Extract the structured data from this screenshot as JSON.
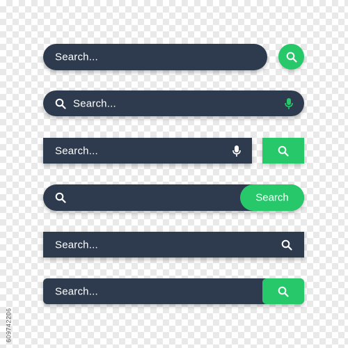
{
  "colors": {
    "bar": "#2e3b4e",
    "accent": "#27c86a",
    "text": "#ffffff"
  },
  "icons": [
    "search-icon",
    "microphone-icon"
  ],
  "search_bars": [
    {
      "placeholder": "Search...",
      "style": "rounded",
      "trailing_icon": "microphone-icon",
      "external_button_icon": "search-icon"
    },
    {
      "placeholder": "Search...",
      "style": "rounded",
      "leading_icon": "search-icon",
      "trailing_icon": "microphone-icon"
    },
    {
      "placeholder": "Search...",
      "style": "square",
      "trailing_icon": "microphone-icon",
      "external_button_icon": "search-icon"
    },
    {
      "placeholder": "",
      "style": "rounded",
      "leading_icon": "search-icon",
      "button_label": "Search"
    },
    {
      "placeholder": "Search...",
      "style": "square",
      "trailing_icon": "search-icon"
    },
    {
      "placeholder": "Search...",
      "style": "square",
      "attached_button_icon": "search-icon"
    }
  ],
  "watermark": "609742206"
}
